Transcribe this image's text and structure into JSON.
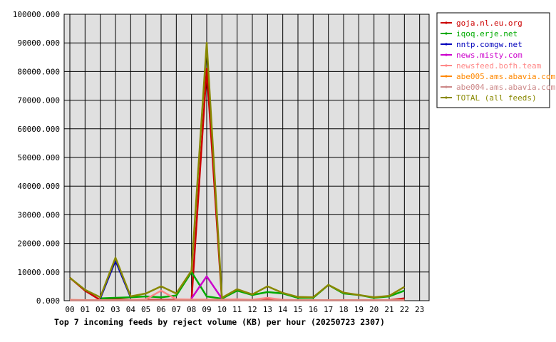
{
  "chart_data": {
    "type": "line",
    "title": "Top 7 incoming feeds by reject volume (KB) per hour (20250723 2307)",
    "xlabel": "",
    "ylabel": "",
    "ylim": [
      0,
      100000
    ],
    "yticks": [
      "0.000",
      "10000.000",
      "20000.000",
      "30000.000",
      "40000.000",
      "50000.000",
      "60000.000",
      "70000.000",
      "80000.000",
      "90000.000",
      "100000.000"
    ],
    "categories": [
      "00",
      "01",
      "02",
      "03",
      "04",
      "05",
      "06",
      "07",
      "08",
      "09",
      "10",
      "11",
      "12",
      "13",
      "14",
      "15",
      "16",
      "17",
      "18",
      "19",
      "20",
      "21",
      "22",
      "23"
    ],
    "grid": true,
    "legend_position": "right",
    "series": [
      {
        "name": "goja.nl.eu.org",
        "color": "#cc0000",
        "values": [
          8000,
          3500,
          200,
          500,
          300,
          300,
          300,
          300,
          300,
          81000,
          400,
          300,
          300,
          300,
          200,
          200,
          200,
          200,
          200,
          200,
          200,
          200,
          800,
          null
        ]
      },
      {
        "name": "iqoq.erje.net",
        "color": "#00aa00",
        "values": [
          null,
          null,
          800,
          1000,
          1200,
          1500,
          1200,
          1800,
          10000,
          1500,
          700,
          3500,
          2000,
          3000,
          2500,
          1000,
          1000,
          5500,
          2500,
          2000,
          1000,
          1500,
          3500,
          null
        ]
      },
      {
        "name": "nntp.comgw.net",
        "color": "#0000bb",
        "values": [
          null,
          null,
          800,
          14000,
          1200,
          null,
          null,
          null,
          null,
          null,
          null,
          null,
          null,
          null,
          null,
          null,
          null,
          null,
          null,
          null,
          null,
          null,
          null,
          null
        ]
      },
      {
        "name": "news.misty.com",
        "color": "#cc00cc",
        "values": [
          null,
          null,
          null,
          null,
          null,
          null,
          null,
          null,
          800,
          8500,
          700,
          null,
          null,
          null,
          null,
          null,
          null,
          null,
          null,
          null,
          null,
          null,
          null,
          null
        ]
      },
      {
        "name": "newsfeed.bofh.team",
        "color": "#ff8888",
        "values": [
          300,
          200,
          200,
          200,
          300,
          500,
          3500,
          500,
          400,
          400,
          300,
          500,
          300,
          1000,
          300,
          200,
          200,
          200,
          200,
          200,
          200,
          200,
          300,
          null
        ]
      },
      {
        "name": "abe005.ams.abavia.com",
        "color": "#ff8800",
        "values": [
          100,
          100,
          100,
          100,
          100,
          100,
          100,
          100,
          100,
          100,
          100,
          100,
          100,
          100,
          100,
          100,
          100,
          100,
          100,
          100,
          100,
          100,
          100,
          null
        ]
      },
      {
        "name": "abe004.ams.abavia.com",
        "color": "#cc8888",
        "values": [
          100,
          100,
          100,
          100,
          100,
          100,
          100,
          100,
          100,
          100,
          100,
          100,
          100,
          100,
          100,
          100,
          100,
          100,
          100,
          100,
          100,
          100,
          100,
          null
        ]
      },
      {
        "name": "TOTAL (all feeds)",
        "color": "#888800",
        "values": [
          8000,
          3800,
          1200,
          15000,
          1500,
          2500,
          5000,
          2500,
          10500,
          90000,
          1000,
          4000,
          2200,
          5000,
          2700,
          1300,
          1200,
          5500,
          2800,
          2000,
          1200,
          1700,
          4800,
          null
        ]
      }
    ]
  }
}
